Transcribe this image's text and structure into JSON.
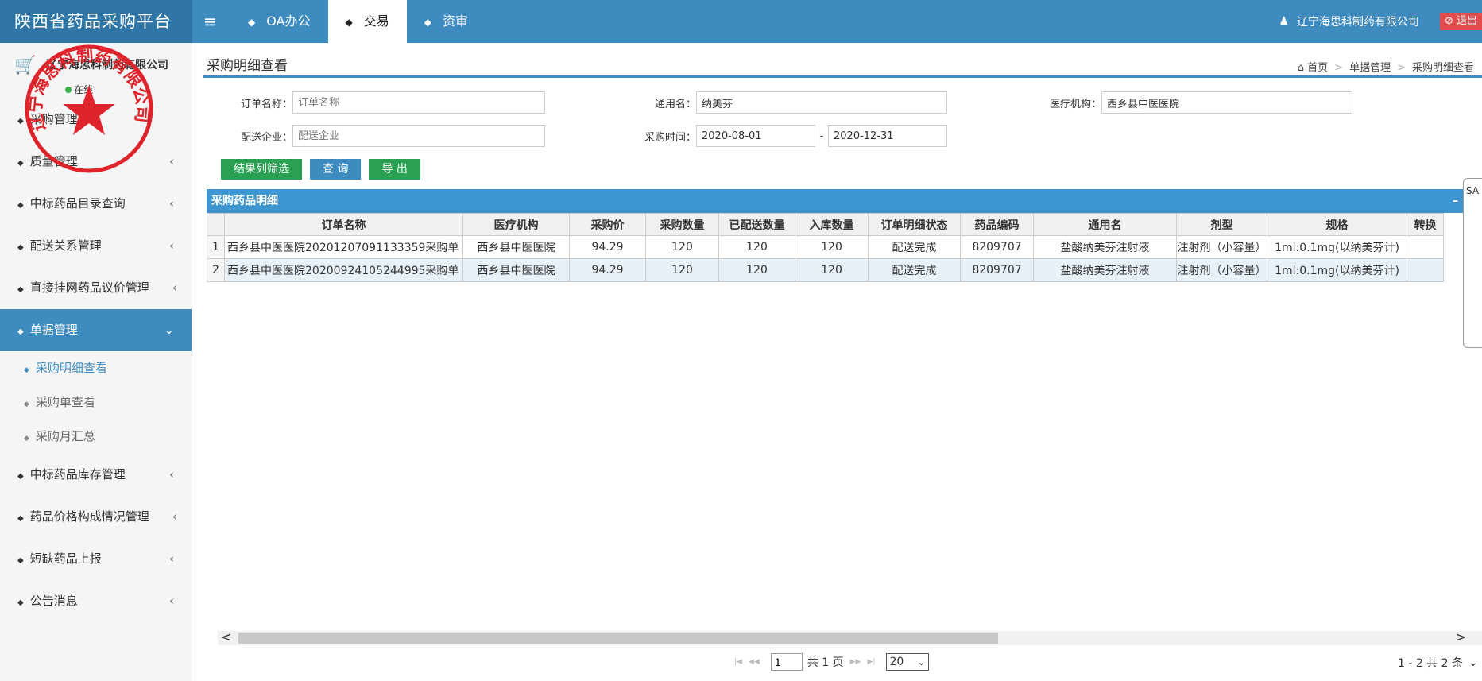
{
  "header": {
    "brand": "陕西省药品采购平台",
    "menu_icon": "≡",
    "nav": [
      {
        "label": "OA办公",
        "active": false
      },
      {
        "label": "交易",
        "active": true
      },
      {
        "label": "资审",
        "active": false
      }
    ],
    "user_company": "辽宁海思科制药有限公司",
    "logout_label": "退出"
  },
  "sidebar": {
    "user_name": "辽宁海思科制药有限公司",
    "status": "在线",
    "items": [
      {
        "label": "采购管理"
      },
      {
        "label": "质量管理"
      },
      {
        "label": "中标药品目录查询"
      },
      {
        "label": "配送关系管理"
      },
      {
        "label": "直接挂网药品议价管理"
      },
      {
        "label": "单据管理"
      },
      {
        "label": "中标药品库存管理"
      },
      {
        "label": "药品价格构成情况管理"
      },
      {
        "label": "短缺药品上报"
      },
      {
        "label": "公告消息"
      }
    ],
    "sub_items": [
      {
        "label": "采购明细查看"
      },
      {
        "label": "采购单查看"
      },
      {
        "label": "采购月汇总"
      }
    ]
  },
  "stamp": {
    "text": "辽宁海思科制药有限公司"
  },
  "page": {
    "title": "采购明细查看",
    "breadcrumb": [
      "首页",
      "单据管理",
      "采购明细查看"
    ]
  },
  "form": {
    "order_name_label": "订单名称：",
    "order_name_placeholder": "订单名称",
    "generic_name_label": "通用名：",
    "generic_name_value": "纳美芬",
    "institution_label": "医疗机构：",
    "institution_value": "西乡县中医医院",
    "distributor_label": "配送企业：",
    "distributor_placeholder": "配送企业",
    "time_label": "采购时间：",
    "date_from": "2020-08-01",
    "date_sep": "-",
    "date_to": "2020-12-31"
  },
  "buttons": {
    "filter": "结果列筛选",
    "query": "查 询",
    "export": "导 出"
  },
  "grid": {
    "title": "采购药品明细",
    "collapse": "–",
    "columns": [
      "订单名称",
      "医疗机构",
      "采购价",
      "采购数量",
      "已配送数量",
      "入库数量",
      "订单明细状态",
      "药品编码",
      "通用名",
      "剂型",
      "规格",
      "转换"
    ],
    "rows": [
      {
        "n": "1",
        "order": "西乡县中医医院20201207091133359采购单",
        "inst": "西乡县中医医院",
        "price": "94.29",
        "qty": "120",
        "shipped": "120",
        "stocked": "120",
        "status": "配送完成",
        "code": "8209707",
        "generic": "盐酸纳美芬注射液",
        "form": "注射剂（小容量）",
        "spec": "1ml:0.1mg(以纳美芬计)"
      },
      {
        "n": "2",
        "order": "西乡县中医医院20200924105244995采购单",
        "inst": "西乡县中医医院",
        "price": "94.29",
        "qty": "120",
        "shipped": "120",
        "stocked": "120",
        "status": "配送完成",
        "code": "8209707",
        "generic": "盐酸纳美芬注射液",
        "form": "注射剂（小容量）",
        "spec": "1ml:0.1mg(以纳美芬计)"
      }
    ]
  },
  "pager": {
    "page_value": "1",
    "page_info": "共 1 页",
    "page_size": "20",
    "total": "1 - 2  共 2 条"
  },
  "side_panel": {
    "label": "SA"
  }
}
